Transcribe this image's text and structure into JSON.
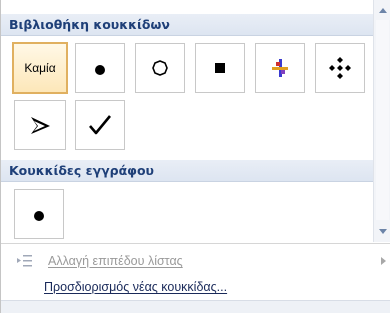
{
  "gallery": {
    "library_header": "Βιβλιοθήκη κουκκίδων",
    "library_items": [
      {
        "kind": "text",
        "label": "Καμία",
        "icon": "none-label",
        "selected": true
      },
      {
        "kind": "glyph",
        "icon": "filled-circle-bullet-icon"
      },
      {
        "kind": "glyph",
        "icon": "hollow-circle-bullet-icon"
      },
      {
        "kind": "glyph",
        "icon": "filled-square-bullet-icon"
      },
      {
        "kind": "glyph",
        "icon": "cross-star-bullet-icon"
      },
      {
        "kind": "glyph",
        "icon": "diamond-cluster-bullet-icon"
      },
      {
        "kind": "glyph",
        "icon": "arrowhead-bullet-icon"
      },
      {
        "kind": "glyph",
        "icon": "checkmark-bullet-icon"
      }
    ],
    "document_header": "Κουκκίδες εγγράφου",
    "document_items": [
      {
        "kind": "glyph",
        "icon": "filled-circle-bullet-icon"
      }
    ]
  },
  "menu": {
    "change_level_label": "Αλλαγή επιπέδου λίστας",
    "define_new_label": "Προσδιορισμός νέας κουκκίδας..."
  },
  "colors": {
    "header_bg": "#dde5f1",
    "header_text": "#1e3f78",
    "selected_border": "#e0b060",
    "disabled_text": "#9a9a9a"
  }
}
